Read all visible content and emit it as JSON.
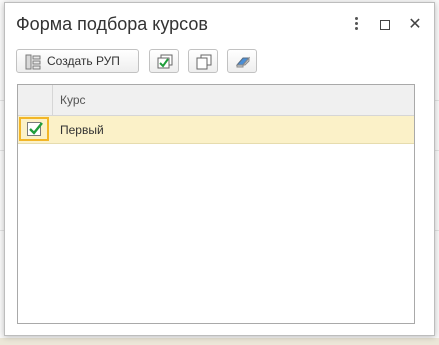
{
  "dialog": {
    "title": "Форма подбора курсов",
    "controls": {
      "more_icon": "more-vertical-icon",
      "maximize_icon": "maximize-icon",
      "close_icon": "close-icon",
      "close_glyph": "✕"
    }
  },
  "toolbar": {
    "create_rup_label": "Создать РУП",
    "create_rup_icon": "structure-icon",
    "check_all_icon": "check-all-icon",
    "copy_icon": "copy-icon",
    "eraser_icon": "eraser-icon"
  },
  "table": {
    "columns": [
      "",
      "Курс"
    ],
    "rows": [
      {
        "checked": true,
        "course": "Первый"
      }
    ]
  },
  "colors": {
    "selected_row": "#fbf1c8",
    "focus_border": "#f2b628",
    "check_green": "#1f9e3b"
  }
}
